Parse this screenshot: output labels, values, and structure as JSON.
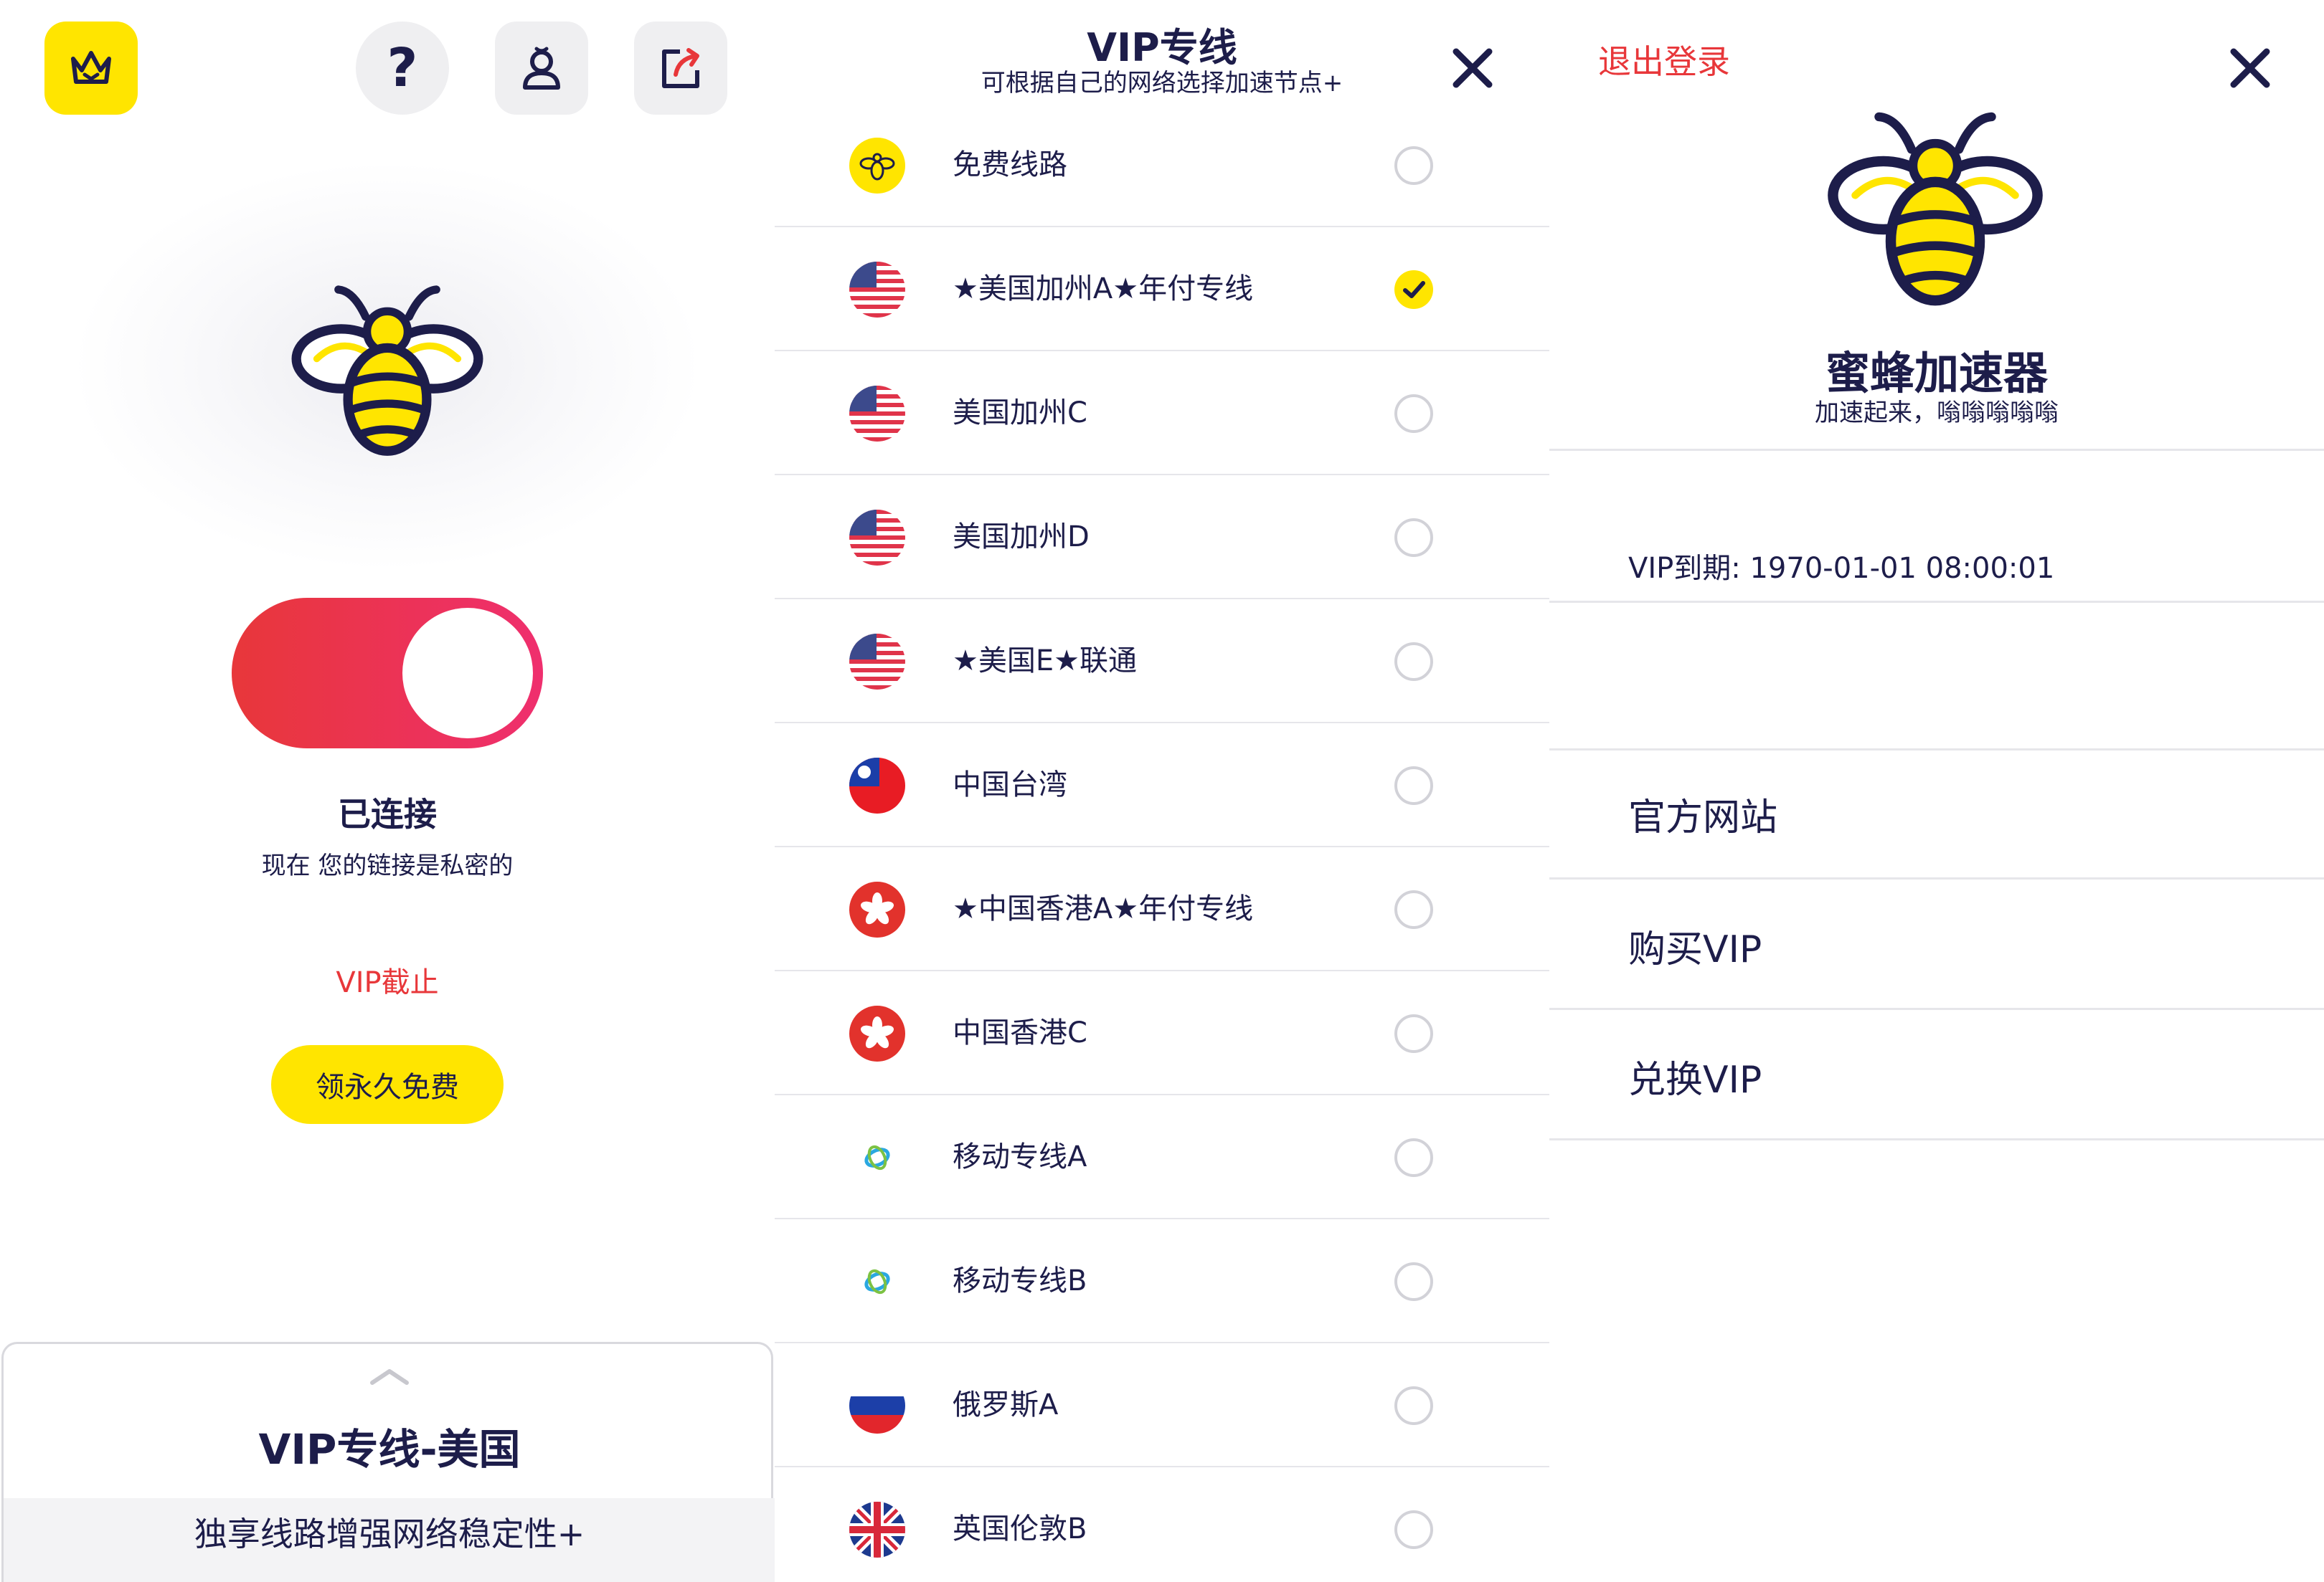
{
  "home": {
    "icons": {
      "crown": "crown-icon",
      "help": "help-icon",
      "user": "user-icon",
      "share": "share-icon"
    },
    "help_glyph": "?",
    "status_title": "已连接",
    "status_subtitle": "现在 您的链接是私密的",
    "vip_expired": "VIP截止",
    "free_button": "领永久免费",
    "bottom_card": {
      "title": "VIP专线-美国",
      "subtitle": "独享线路增强网络稳定性+"
    },
    "toggle_on": true
  },
  "lines": {
    "title": "VIP专线",
    "subtitle": "可根据自己的网络选择加速节点+",
    "items": [
      {
        "label": "免费线路",
        "flag": "bee",
        "selected": false
      },
      {
        "label": "★美国加州A★年付专线",
        "flag": "us",
        "selected": true
      },
      {
        "label": "美国加州C",
        "flag": "us",
        "selected": false
      },
      {
        "label": "美国加州D",
        "flag": "us",
        "selected": false
      },
      {
        "label": "★美国E★联通",
        "flag": "us",
        "selected": false
      },
      {
        "label": "中国台湾",
        "flag": "tw",
        "selected": false
      },
      {
        "label": "★中国香港A★年付专线",
        "flag": "hk",
        "selected": false
      },
      {
        "label": "中国香港C",
        "flag": "hk",
        "selected": false
      },
      {
        "label": "移动专线A",
        "flag": "cmcc",
        "selected": false
      },
      {
        "label": "移动专线B",
        "flag": "cmcc",
        "selected": false
      },
      {
        "label": "俄罗斯A",
        "flag": "ru",
        "selected": false
      },
      {
        "label": "英国伦敦B",
        "flag": "uk",
        "selected": false
      }
    ]
  },
  "account": {
    "logout": "退出登录",
    "app_name": "蜜蜂加速器",
    "slogan": "加速起来，嗡嗡嗡嗡嗡",
    "vip_expiry": "VIP到期: 1970-01-01 08:00:01",
    "menu": {
      "website": "官方网站",
      "buy_vip": "购买VIP",
      "redeem_vip": "兑换VIP"
    }
  },
  "colors": {
    "brand_yellow": "#ffe500",
    "navy": "#1d1d4a",
    "accent_red": "#e8373a",
    "toggle_pink": "#ef2f6e"
  }
}
